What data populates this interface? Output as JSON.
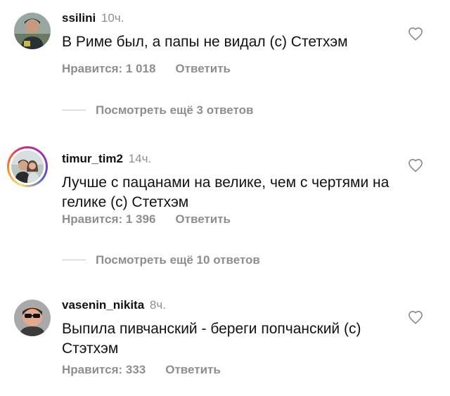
{
  "comments": [
    {
      "username": "ssilini",
      "time": "10ч.",
      "text": "В Риме был, а папы не видал (с) Стетхэм",
      "likes": "Нравится: 1 018",
      "reply": "Ответить",
      "icon": "heart-outline"
    },
    {
      "username": "timur_tim2",
      "time": "14ч.",
      "text": "Лучше с пацанами на велике, чем с чертями на гелике (с) Стетхэм",
      "likes": "Нравится: 1 396",
      "reply": "Ответить",
      "icon": "heart-outline"
    },
    {
      "username": "vasenin_nikita",
      "time": "8ч.",
      "text": "Выпила пивчанский - береги попчанский (с) Стэтхэм",
      "likes": "Нравится: 333",
      "reply": "Ответить",
      "icon": "heart-outline"
    }
  ],
  "view_more": [
    "Посмотреть ещё 3 ответов",
    "Посмотреть ещё 10 ответов"
  ],
  "colors": {
    "text": "#111111",
    "secondary": "#8e8e8e",
    "story_ring": [
      "#feda75",
      "#fa7e1e",
      "#d62976",
      "#962fbf",
      "#4f5bd5"
    ]
  }
}
